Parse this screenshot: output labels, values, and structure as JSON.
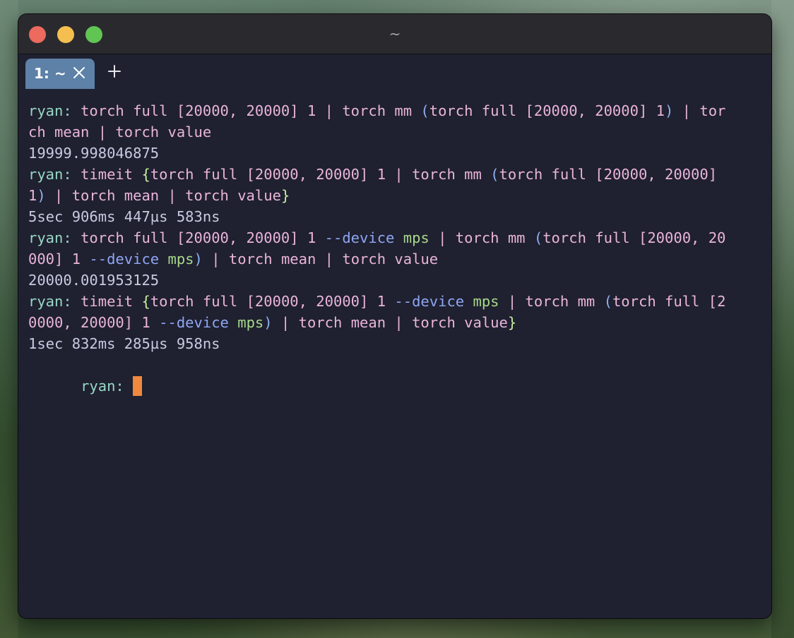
{
  "window": {
    "title": "~"
  },
  "tabs": {
    "active_label": "1: ~",
    "close_icon": "close-icon",
    "new_tab_icon": "plus-icon"
  },
  "terminal": {
    "lines": [
      [
        {
          "text": "ryan: ",
          "role": "prompt"
        },
        {
          "text": "torch full [20000, 20000] 1 | torch mm ",
          "role": "cmd"
        },
        {
          "text": "(",
          "role": "paren"
        },
        {
          "text": "torch full [20000, 20000] 1",
          "role": "cmd"
        },
        {
          "text": ")",
          "role": "paren"
        },
        {
          "text": " | tor",
          "role": "cmd"
        }
      ],
      [
        {
          "text": "ch mean | torch value",
          "role": "cmd"
        }
      ],
      [
        {
          "text": "19999.998046875",
          "role": "out"
        }
      ],
      [
        {
          "text": "ryan: ",
          "role": "prompt"
        },
        {
          "text": "timeit ",
          "role": "cmd"
        },
        {
          "text": "{",
          "role": "brace"
        },
        {
          "text": "torch full [20000, 20000] 1 | torch mm ",
          "role": "cmd"
        },
        {
          "text": "(",
          "role": "paren"
        },
        {
          "text": "torch full [20000, 20000]",
          "role": "cmd"
        }
      ],
      [
        {
          "text": "1",
          "role": "cmd"
        },
        {
          "text": ")",
          "role": "paren"
        },
        {
          "text": " | torch mean | torch value",
          "role": "cmd"
        },
        {
          "text": "}",
          "role": "brace"
        }
      ],
      [
        {
          "text": "5sec 906ms 447µs 583ns",
          "role": "out"
        }
      ],
      [
        {
          "text": "ryan: ",
          "role": "prompt"
        },
        {
          "text": "torch full [20000, 20000] 1 ",
          "role": "cmd"
        },
        {
          "text": "--device",
          "role": "flag"
        },
        {
          "text": " ",
          "role": "cmd"
        },
        {
          "text": "mps",
          "role": "str"
        },
        {
          "text": " | torch mm ",
          "role": "cmd"
        },
        {
          "text": "(",
          "role": "paren"
        },
        {
          "text": "torch full [20000, 20",
          "role": "cmd"
        }
      ],
      [
        {
          "text": "000] 1 ",
          "role": "cmd"
        },
        {
          "text": "--device",
          "role": "flag"
        },
        {
          "text": " ",
          "role": "cmd"
        },
        {
          "text": "mps",
          "role": "str"
        },
        {
          "text": ")",
          "role": "paren"
        },
        {
          "text": " | torch mean | torch value",
          "role": "cmd"
        }
      ],
      [
        {
          "text": "20000.001953125",
          "role": "out"
        }
      ],
      [
        {
          "text": "ryan: ",
          "role": "prompt"
        },
        {
          "text": "timeit ",
          "role": "cmd"
        },
        {
          "text": "{",
          "role": "brace"
        },
        {
          "text": "torch full [20000, 20000] 1 ",
          "role": "cmd"
        },
        {
          "text": "--device",
          "role": "flag"
        },
        {
          "text": " ",
          "role": "cmd"
        },
        {
          "text": "mps",
          "role": "str"
        },
        {
          "text": " | torch mm ",
          "role": "cmd"
        },
        {
          "text": "(",
          "role": "paren"
        },
        {
          "text": "torch full [2",
          "role": "cmd"
        }
      ],
      [
        {
          "text": "0000, 20000] 1 ",
          "role": "cmd"
        },
        {
          "text": "--device",
          "role": "flag"
        },
        {
          "text": " ",
          "role": "cmd"
        },
        {
          "text": "mps",
          "role": "str"
        },
        {
          "text": ")",
          "role": "paren"
        },
        {
          "text": " | torch mean | torch value",
          "role": "cmd"
        },
        {
          "text": "}",
          "role": "brace"
        }
      ],
      [
        {
          "text": "1sec 832ms 285µs 958ns",
          "role": "out"
        }
      ]
    ],
    "prompt_line": {
      "text": "ryan: ",
      "role": "prompt"
    }
  },
  "colors": {
    "window_bg": "#1f2030",
    "titlebar_bg": "#2a2a2e",
    "tab_active_bg": "#5d81a7",
    "prompt": "#97d8c4",
    "cmd": "#e9b5da",
    "paren": "#8fb0f0",
    "brace": "#c6ec9e",
    "flag": "#8fa6f2",
    "str": "#a8d98a",
    "out": "#c8cbe0",
    "cursor": "#f0883e"
  }
}
